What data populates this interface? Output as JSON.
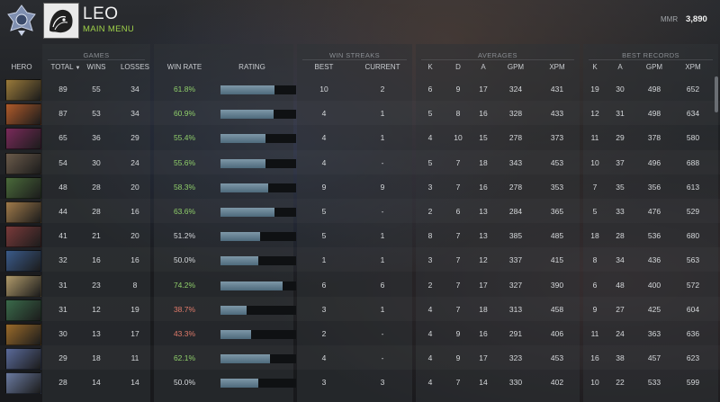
{
  "header": {
    "player_name": "LEO",
    "menu_link": "MAIN MENU",
    "mmr_label": "MMR",
    "mmr_value": "3,890"
  },
  "groups": {
    "games": "GAMES",
    "win_streaks": "WIN STREAKS",
    "averages": "AVERAGES",
    "best_records": "BEST RECORDS"
  },
  "columns": {
    "hero": "HERO",
    "total": "TOTAL",
    "wins": "WINS",
    "losses": "LOSSES",
    "win_rate": "WIN RATE",
    "rating": "RATING",
    "streak_best": "BEST",
    "streak_current": "CURRENT",
    "avg_k": "K",
    "avg_d": "D",
    "avg_a": "A",
    "avg_gpm": "GPM",
    "avg_xpm": "XPM",
    "best_k": "K",
    "best_a": "A",
    "best_gpm": "GPM",
    "best_xpm": "XPM"
  },
  "colors": {
    "win_rate_high": "#8fce6a",
    "win_rate_low": "#e07a6a",
    "win_rate_mid": "#d6d9dc",
    "accent_green": "#9fd14a"
  },
  "rows": [
    {
      "hero_icon": "hero-portrait-1",
      "icon_color": "#9a7a3a",
      "total": "89",
      "wins": "55",
      "losses": "34",
      "win_rate": "61.8%",
      "rating": 0.72,
      "streak_best": "10",
      "streak_current": "2",
      "avg_k": "6",
      "avg_d": "9",
      "avg_a": "17",
      "avg_gpm": "324",
      "avg_xpm": "431",
      "best_k": "19",
      "best_a": "30",
      "best_gpm": "498",
      "best_xpm": "652"
    },
    {
      "hero_icon": "hero-portrait-2",
      "icon_color": "#b05a2a",
      "total": "87",
      "wins": "53",
      "losses": "34",
      "win_rate": "60.9%",
      "rating": 0.7,
      "streak_best": "4",
      "streak_current": "1",
      "avg_k": "5",
      "avg_d": "8",
      "avg_a": "16",
      "avg_gpm": "328",
      "avg_xpm": "433",
      "best_k": "12",
      "best_a": "31",
      "best_gpm": "498",
      "best_xpm": "634"
    },
    {
      "hero_icon": "hero-portrait-3",
      "icon_color": "#7a2a5a",
      "total": "65",
      "wins": "36",
      "losses": "29",
      "win_rate": "55.4%",
      "rating": 0.59,
      "streak_best": "4",
      "streak_current": "1",
      "avg_k": "4",
      "avg_d": "10",
      "avg_a": "15",
      "avg_gpm": "278",
      "avg_xpm": "373",
      "best_k": "11",
      "best_a": "29",
      "best_gpm": "378",
      "best_xpm": "580"
    },
    {
      "hero_icon": "hero-portrait-4",
      "icon_color": "#6a5a4a",
      "total": "54",
      "wins": "30",
      "losses": "24",
      "win_rate": "55.6%",
      "rating": 0.59,
      "streak_best": "4",
      "streak_current": "-",
      "avg_k": "5",
      "avg_d": "7",
      "avg_a": "18",
      "avg_gpm": "343",
      "avg_xpm": "453",
      "best_k": "10",
      "best_a": "37",
      "best_gpm": "496",
      "best_xpm": "688"
    },
    {
      "hero_icon": "hero-portrait-5",
      "icon_color": "#4a6a3a",
      "total": "48",
      "wins": "28",
      "losses": "20",
      "win_rate": "58.3%",
      "rating": 0.63,
      "streak_best": "9",
      "streak_current": "9",
      "avg_k": "3",
      "avg_d": "7",
      "avg_a": "16",
      "avg_gpm": "278",
      "avg_xpm": "353",
      "best_k": "7",
      "best_a": "35",
      "best_gpm": "356",
      "best_xpm": "613"
    },
    {
      "hero_icon": "hero-portrait-6",
      "icon_color": "#a07a4a",
      "total": "44",
      "wins": "28",
      "losses": "16",
      "win_rate": "63.6%",
      "rating": 0.71,
      "streak_best": "5",
      "streak_current": "-",
      "avg_k": "2",
      "avg_d": "6",
      "avg_a": "13",
      "avg_gpm": "284",
      "avg_xpm": "365",
      "best_k": "5",
      "best_a": "33",
      "best_gpm": "476",
      "best_xpm": "529"
    },
    {
      "hero_icon": "hero-portrait-7",
      "icon_color": "#7a3a3a",
      "total": "41",
      "wins": "21",
      "losses": "20",
      "win_rate": "51.2%",
      "rating": 0.52,
      "streak_best": "5",
      "streak_current": "1",
      "avg_k": "8",
      "avg_d": "7",
      "avg_a": "13",
      "avg_gpm": "385",
      "avg_xpm": "485",
      "best_k": "18",
      "best_a": "28",
      "best_gpm": "536",
      "best_xpm": "680"
    },
    {
      "hero_icon": "hero-portrait-8",
      "icon_color": "#3a5a8a",
      "total": "32",
      "wins": "16",
      "losses": "16",
      "win_rate": "50.0%",
      "rating": 0.5,
      "streak_best": "1",
      "streak_current": "1",
      "avg_k": "3",
      "avg_d": "7",
      "avg_a": "12",
      "avg_gpm": "337",
      "avg_xpm": "415",
      "best_k": "8",
      "best_a": "34",
      "best_gpm": "436",
      "best_xpm": "563"
    },
    {
      "hero_icon": "hero-portrait-9",
      "icon_color": "#b09a6a",
      "total": "31",
      "wins": "23",
      "losses": "8",
      "win_rate": "74.2%",
      "rating": 0.82,
      "streak_best": "6",
      "streak_current": "6",
      "avg_k": "2",
      "avg_d": "7",
      "avg_a": "17",
      "avg_gpm": "327",
      "avg_xpm": "390",
      "best_k": "6",
      "best_a": "48",
      "best_gpm": "400",
      "best_xpm": "572"
    },
    {
      "hero_icon": "hero-portrait-10",
      "icon_color": "#3a6a4a",
      "total": "31",
      "wins": "12",
      "losses": "19",
      "win_rate": "38.7%",
      "rating": 0.35,
      "streak_best": "3",
      "streak_current": "1",
      "avg_k": "4",
      "avg_d": "7",
      "avg_a": "18",
      "avg_gpm": "313",
      "avg_xpm": "458",
      "best_k": "9",
      "best_a": "27",
      "best_gpm": "425",
      "best_xpm": "604"
    },
    {
      "hero_icon": "hero-portrait-11",
      "icon_color": "#9a6a2a",
      "total": "30",
      "wins": "13",
      "losses": "17",
      "win_rate": "43.3%",
      "rating": 0.41,
      "streak_best": "2",
      "streak_current": "-",
      "avg_k": "4",
      "avg_d": "9",
      "avg_a": "16",
      "avg_gpm": "291",
      "avg_xpm": "406",
      "best_k": "11",
      "best_a": "24",
      "best_gpm": "363",
      "best_xpm": "636"
    },
    {
      "hero_icon": "hero-portrait-12",
      "icon_color": "#5a6a9a",
      "total": "29",
      "wins": "18",
      "losses": "11",
      "win_rate": "62.1%",
      "rating": 0.65,
      "streak_best": "4",
      "streak_current": "-",
      "avg_k": "4",
      "avg_d": "9",
      "avg_a": "17",
      "avg_gpm": "323",
      "avg_xpm": "453",
      "best_k": "16",
      "best_a": "38",
      "best_gpm": "457",
      "best_xpm": "623"
    },
    {
      "hero_icon": "hero-portrait-13",
      "icon_color": "#6a7aa0",
      "total": "28",
      "wins": "14",
      "losses": "14",
      "win_rate": "50.0%",
      "rating": 0.5,
      "streak_best": "3",
      "streak_current": "3",
      "avg_k": "4",
      "avg_d": "7",
      "avg_a": "14",
      "avg_gpm": "330",
      "avg_xpm": "402",
      "best_k": "10",
      "best_a": "22",
      "best_gpm": "533",
      "best_xpm": "599"
    }
  ]
}
